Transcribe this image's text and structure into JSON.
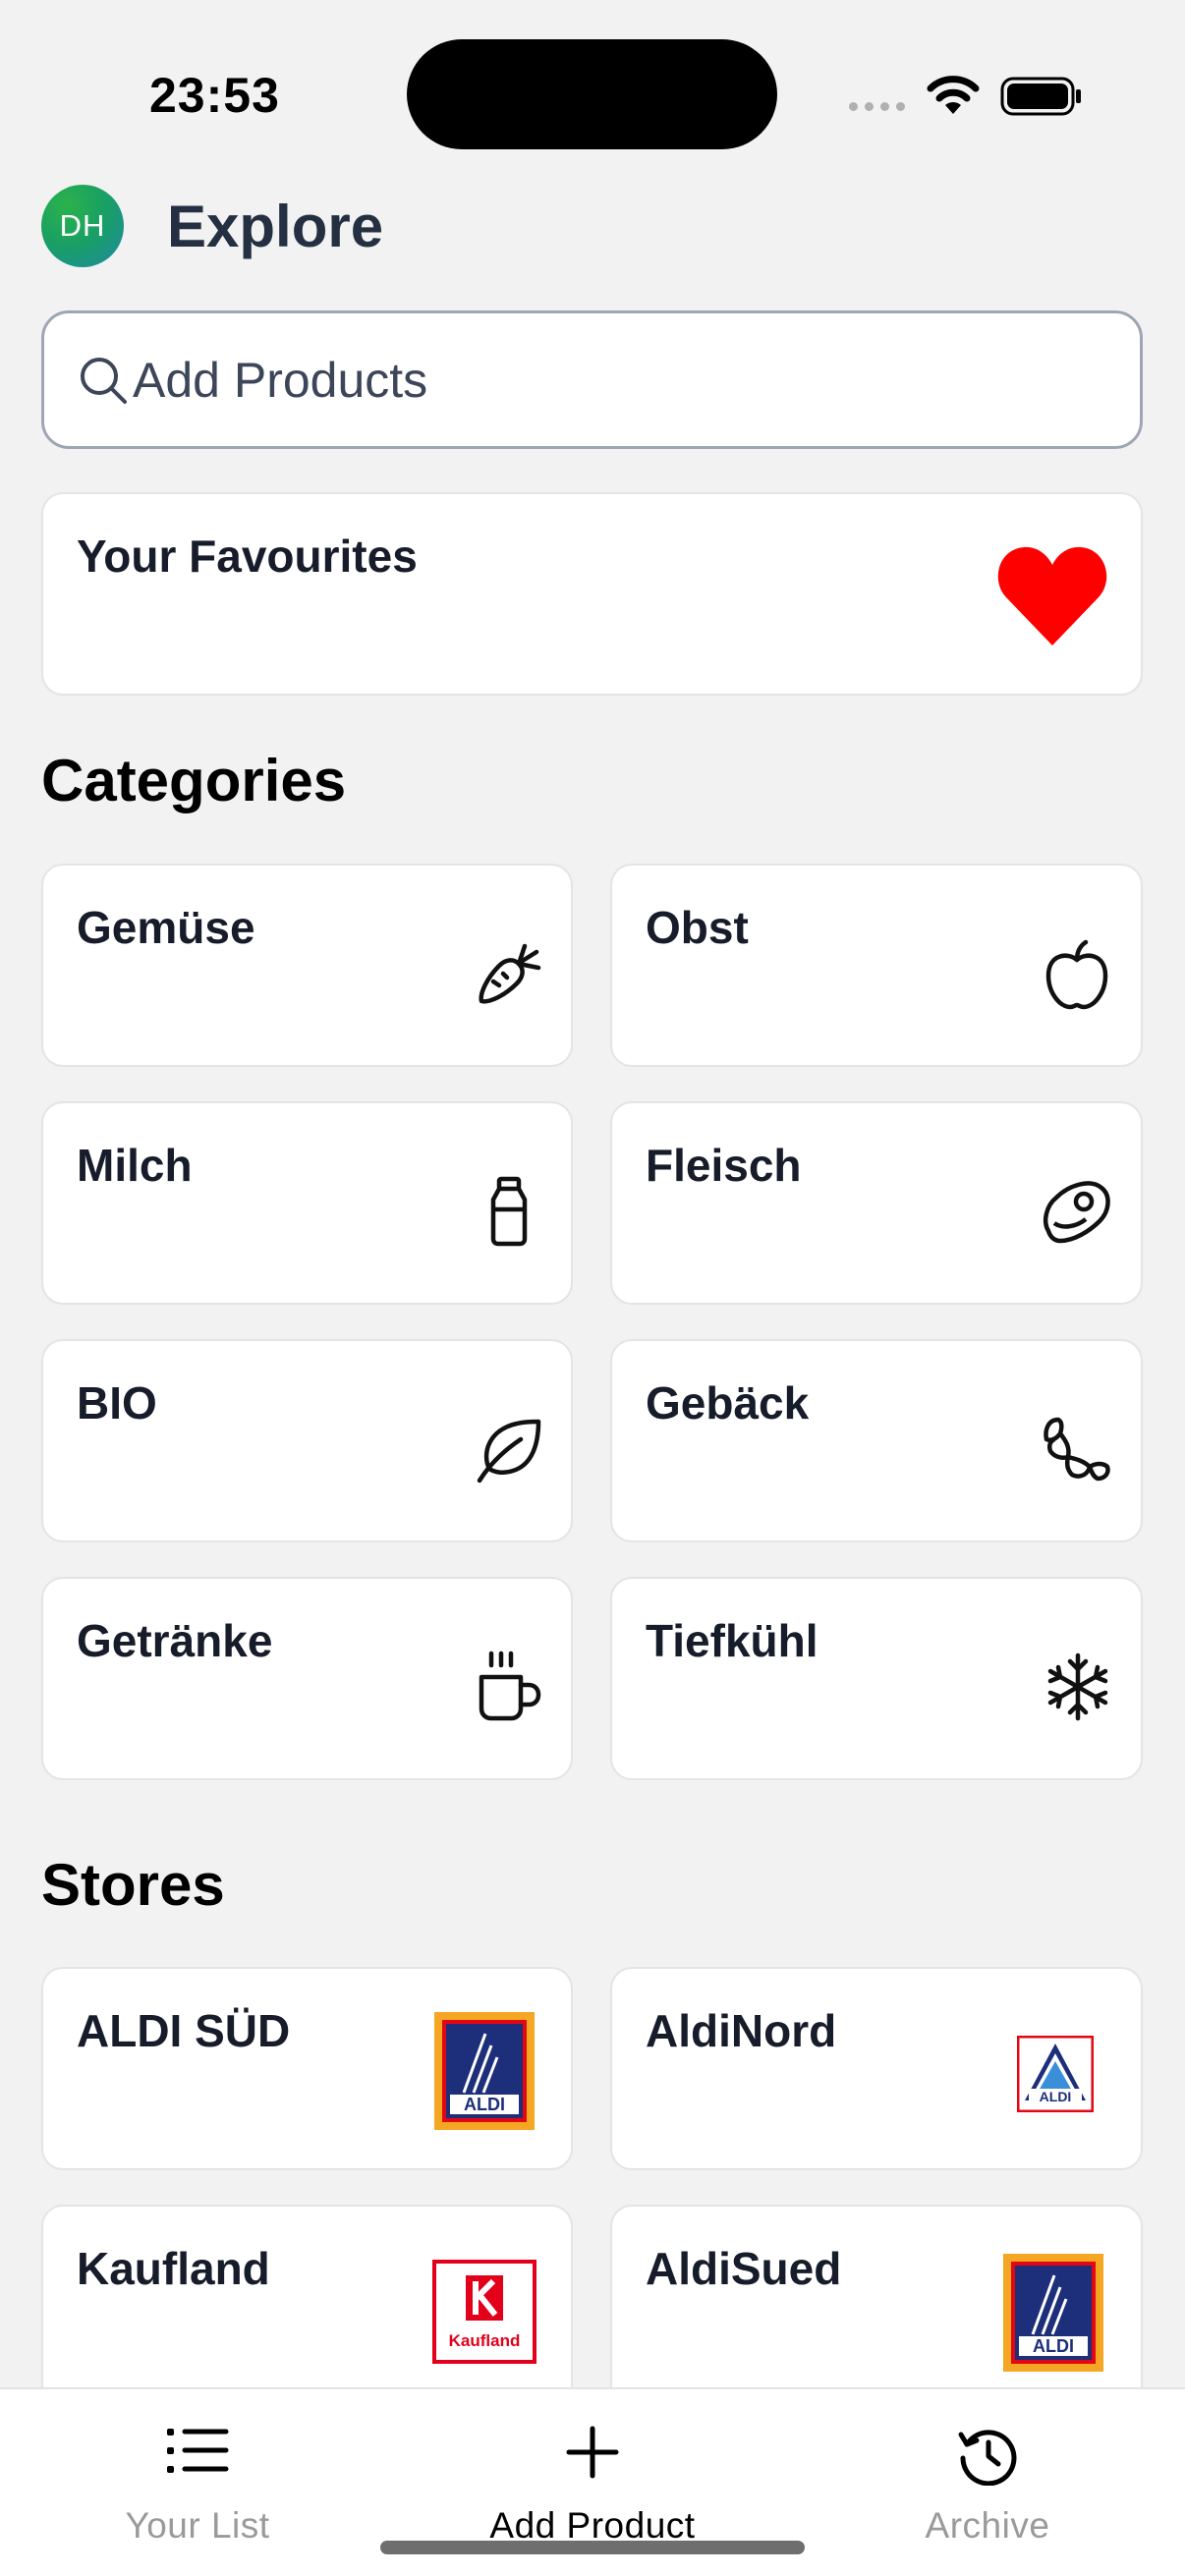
{
  "status_bar": {
    "time": "23:53"
  },
  "header": {
    "avatar_initials": "DH",
    "title": "Explore"
  },
  "search": {
    "placeholder": "Add Products"
  },
  "favourites": {
    "label": "Your Favourites",
    "icon": "heart-icon",
    "icon_color": "#ff0000"
  },
  "categories": {
    "title": "Categories",
    "items": [
      {
        "label": "Gemüse",
        "icon": "carrot-icon"
      },
      {
        "label": "Obst",
        "icon": "apple-icon"
      },
      {
        "label": "Milch",
        "icon": "milk-bottle-icon"
      },
      {
        "label": "Fleisch",
        "icon": "steak-icon"
      },
      {
        "label": "BIO",
        "icon": "leaf-icon"
      },
      {
        "label": "Gebäck",
        "icon": "croissant-icon"
      },
      {
        "label": "Getränke",
        "icon": "mug-icon"
      },
      {
        "label": "Tiefkühl",
        "icon": "snowflake-icon"
      }
    ]
  },
  "stores": {
    "title": "Stores",
    "items": [
      {
        "label": "ALDI SÜD",
        "logo": "aldi-sued-logo",
        "logo_text": "ALDI"
      },
      {
        "label": "AldiNord",
        "logo": "aldi-nord-logo",
        "logo_text": "ALDI"
      },
      {
        "label": "Kaufland",
        "logo": "kaufland-logo",
        "logo_text": "Kaufland"
      },
      {
        "label": "AldiSued",
        "logo": "aldi-sued-logo",
        "logo_text": "ALDI"
      }
    ]
  },
  "tab_bar": {
    "tabs": [
      {
        "label": "Your List",
        "icon": "list-icon",
        "active": false
      },
      {
        "label": "Add Product",
        "icon": "plus-icon",
        "active": true
      },
      {
        "label": "Archive",
        "icon": "history-icon",
        "active": false
      }
    ]
  },
  "colors": {
    "background": "#f2f2f2",
    "aldi_blue": "#1d2e7a",
    "aldi_orange": "#f5a623",
    "kaufland_red": "#e3001b"
  }
}
